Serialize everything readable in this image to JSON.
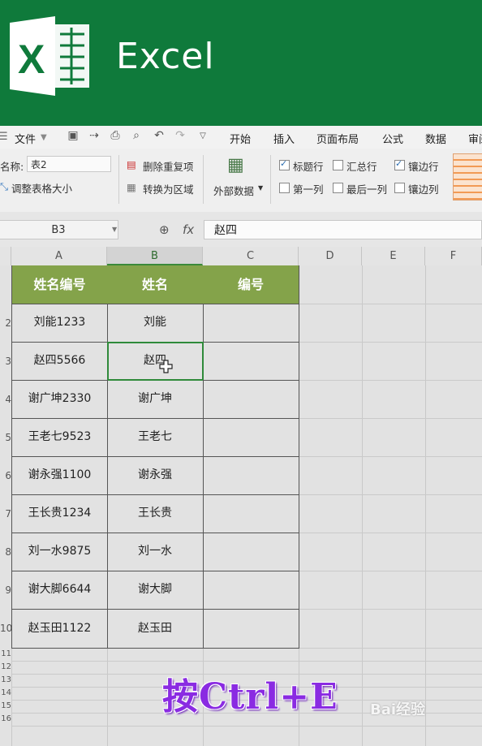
{
  "banner": {
    "app_name": "Excel"
  },
  "menubar": {
    "file_label": "文件",
    "tabs": [
      "开始",
      "插入",
      "页面布局",
      "公式",
      "数据",
      "审阅"
    ]
  },
  "ribbon": {
    "name_label": "名称:",
    "table_name": "表2",
    "resize_label": "调整表格大小",
    "remove_dup_label": "删除重复项",
    "convert_label": "转换为区域",
    "external_data_label": "外部数据",
    "options": [
      {
        "label": "标题行",
        "checked": true
      },
      {
        "label": "汇总行",
        "checked": false
      },
      {
        "label": "镶边行",
        "checked": true
      },
      {
        "label": "第一列",
        "checked": false
      },
      {
        "label": "最后一列",
        "checked": false
      },
      {
        "label": "镶边列",
        "checked": false
      }
    ]
  },
  "formula_bar": {
    "cell_ref": "B3",
    "fx": "fx",
    "value": "赵四"
  },
  "sheet": {
    "columns": [
      "A",
      "B",
      "C",
      "D",
      "E",
      "F"
    ],
    "row_numbers": [
      "2",
      "3",
      "4",
      "5",
      "6",
      "7",
      "8",
      "9",
      "10",
      "11",
      "12",
      "13",
      "14",
      "15",
      "16"
    ],
    "headers": [
      "姓名编号",
      "姓名",
      "编号"
    ],
    "rows": [
      [
        "刘能1233",
        "刘能",
        ""
      ],
      [
        "赵四5566",
        "赵四",
        ""
      ],
      [
        "谢广坤2330",
        "谢广坤",
        ""
      ],
      [
        "王老七9523",
        "王老七",
        ""
      ],
      [
        "谢永强1100",
        "谢永强",
        ""
      ],
      [
        "王长贵1234",
        "王长贵",
        ""
      ],
      [
        "刘一水9875",
        "刘一水",
        ""
      ],
      [
        "谢大脚6644",
        "谢大脚",
        ""
      ],
      [
        "赵玉田1122",
        "赵玉田",
        ""
      ]
    ],
    "active_cell": "B3"
  },
  "caption": "按Ctrl+E",
  "watermark": "Bai经验",
  "colors": {
    "banner": "#0f7a3b",
    "header_fill": "#84a34a",
    "caption": "#8a2be2",
    "selection": "#2f8a3a"
  }
}
